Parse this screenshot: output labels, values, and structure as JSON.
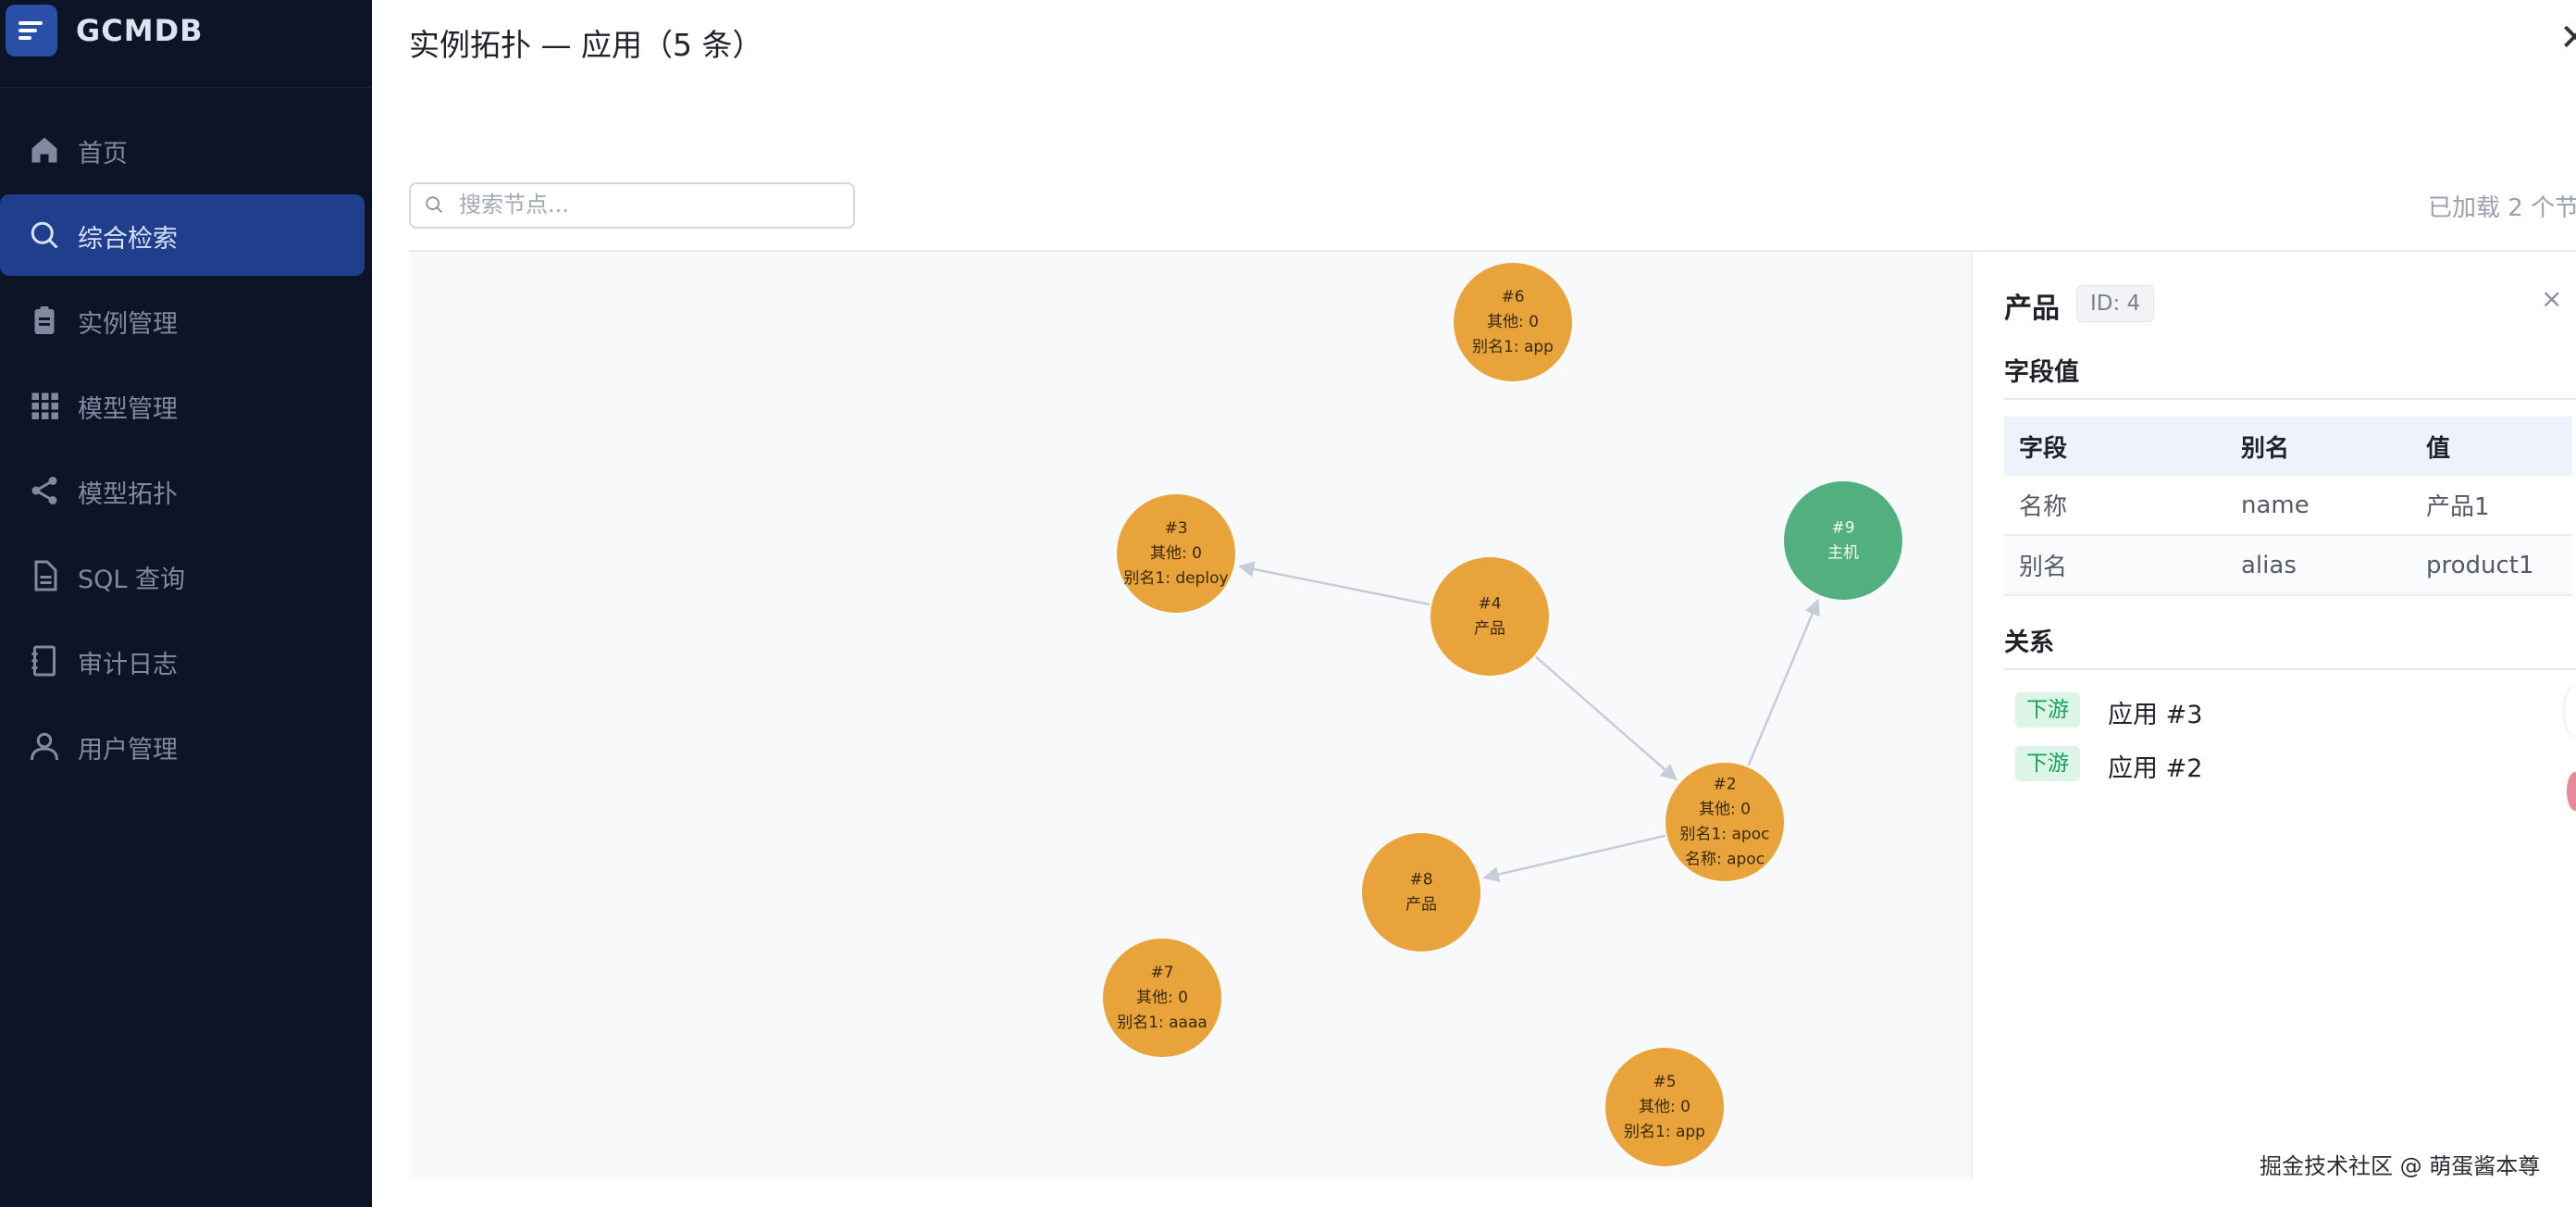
{
  "app": {
    "title": "GCMDB"
  },
  "sidebar": {
    "items": [
      {
        "label": "首页",
        "icon": "home-icon",
        "active": false
      },
      {
        "label": "综合检索",
        "icon": "search-icon",
        "active": true
      },
      {
        "label": "实例管理",
        "icon": "clipboard-icon",
        "active": false
      },
      {
        "label": "模型管理",
        "icon": "grid-icon",
        "active": false
      },
      {
        "label": "模型拓扑",
        "icon": "share-icon",
        "active": false
      },
      {
        "label": "SQL 查询",
        "icon": "document-icon",
        "active": false
      },
      {
        "label": "审计日志",
        "icon": "notebook-icon",
        "active": false
      },
      {
        "label": "用户管理",
        "icon": "user-icon",
        "active": false
      }
    ]
  },
  "drawer": {
    "title": "实例拓扑 — 应用（5 条）",
    "search_placeholder": "搜索节点...",
    "search_value": "",
    "loaded_info": "已加载 2 个节"
  },
  "graph": {
    "colors": {
      "app": "#e8a33a",
      "host": "#52b07f",
      "edge": "#c7ccd6"
    },
    "nodes": [
      {
        "id": "6",
        "lines": [
          "#6",
          "其他: 0",
          "别名1: app"
        ],
        "kind": "app"
      },
      {
        "id": "3",
        "lines": [
          "#3",
          "其他: 0",
          "别名1: deploy"
        ],
        "kind": "app"
      },
      {
        "id": "4",
        "lines": [
          "#4",
          "产品"
        ],
        "kind": "app"
      },
      {
        "id": "9",
        "lines": [
          "#9",
          "主机"
        ],
        "kind": "host"
      },
      {
        "id": "2",
        "lines": [
          "#2",
          "其他: 0",
          "别名1: apoc",
          "名称: apoc"
        ],
        "kind": "app"
      },
      {
        "id": "8",
        "lines": [
          "#8",
          "产品"
        ],
        "kind": "app"
      },
      {
        "id": "7",
        "lines": [
          "#7",
          "其他: 0",
          "别名1: aaaa"
        ],
        "kind": "app"
      },
      {
        "id": "5",
        "lines": [
          "#5",
          "其他: 0",
          "别名1: app"
        ],
        "kind": "app"
      }
    ],
    "edges": [
      {
        "from": "4",
        "to": "3"
      },
      {
        "from": "4",
        "to": "2"
      },
      {
        "from": "2",
        "to": "9"
      },
      {
        "from": "2",
        "to": "8"
      }
    ]
  },
  "detail": {
    "title": "产品",
    "id_badge": "ID: 4",
    "close_label": "×",
    "fields_heading": "字段值",
    "columns": [
      "字段",
      "别名",
      "值"
    ],
    "rows": [
      [
        "名称",
        "name",
        "产品1"
      ],
      [
        "别名",
        "alias",
        "product1"
      ]
    ],
    "relations_heading": "关系",
    "relations": [
      {
        "tag": "下游",
        "target": "应用 #3"
      },
      {
        "tag": "下游",
        "target": "应用 #2"
      }
    ]
  },
  "watermark": "掘金技术社区 @ 萌蛋酱本尊"
}
